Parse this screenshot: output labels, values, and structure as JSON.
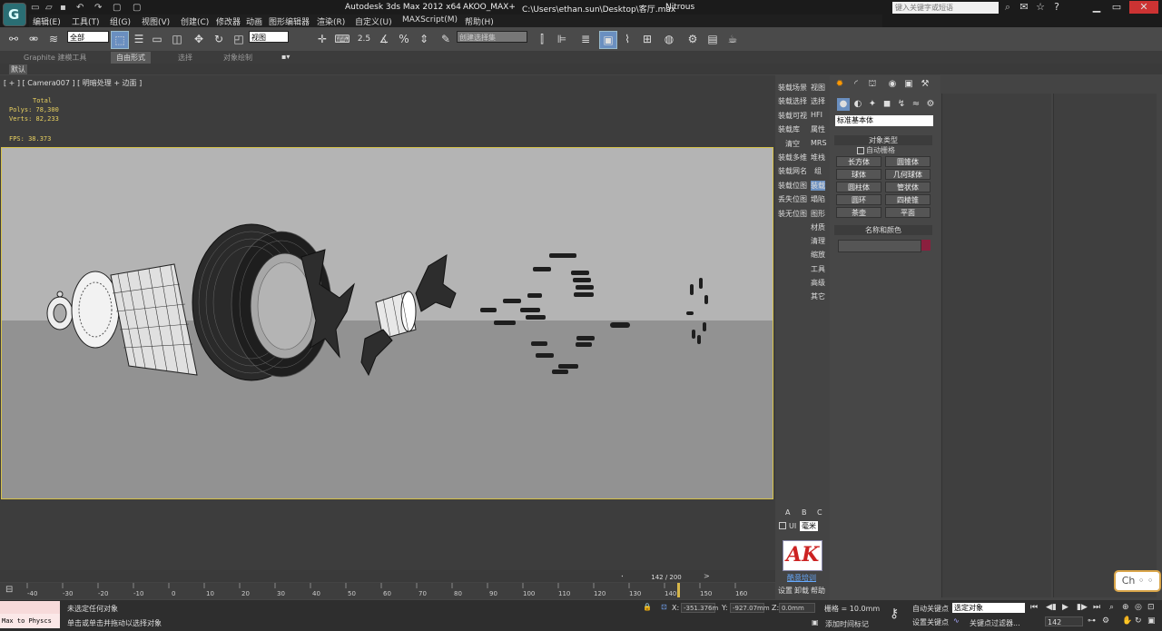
{
  "title_bar": {
    "app_title": "Autodesk 3ds Max  2012 x64",
    "plugin": "AKOO_MAX+",
    "file_path": "C:\\Users\\ethan.sun\\Desktop\\客厅.max",
    "renderer": "Nitrous",
    "search_placeholder": "键入关键字或短语"
  },
  "menu": [
    "编辑(E)",
    "工具(T)",
    "组(G)",
    "视图(V)",
    "创建(C)",
    "修改器",
    "动画",
    "图形编辑器",
    "渲染(R)",
    "自定义(U)",
    "MAXScript(M)",
    "帮助(H)"
  ],
  "toolbar": {
    "selection_filter": "全部",
    "ref_coord": "视图",
    "snap_label": "2.5",
    "named_selection": "创建选择集"
  },
  "ribbon": {
    "tabs": [
      "Graphite 建模工具",
      "自由形式",
      "选择",
      "对象绘制"
    ],
    "active_tab": "自由形式",
    "sub_label": "默认"
  },
  "viewport": {
    "label": "[ + ] [ Camera007 ] [ 明暗处理 + 边面 ]",
    "stats": {
      "total_label": "Total",
      "polys": "Polys: 78,300",
      "verts": "Verts: 82,233",
      "fps": "FPS:   38.373"
    }
  },
  "mid_panel": {
    "left_buttons": [
      "装载场景",
      "装载选择",
      "装载可视",
      "装载库",
      "清空",
      "装载多维",
      "装载网名",
      "装载位图",
      "丢失位图",
      "装无位图"
    ],
    "right_buttons": [
      "视图",
      "选择",
      "HFI",
      "属性",
      "MRS",
      "堆栈",
      "组",
      "装载",
      "塌陷",
      "图形",
      "材质",
      "清理",
      "缩放",
      "工具",
      "高级",
      "其它"
    ],
    "abc": [
      "A",
      "B",
      "C"
    ],
    "ui_label": "UI",
    "unit": "毫米",
    "logo": "AK",
    "training": "酷意培训",
    "bottom_buttons": [
      "设置",
      "卸载",
      "帮助"
    ]
  },
  "command_panel": {
    "category": "标准基本体",
    "object_type_header": "对象类型",
    "autogrid_label": "自动栅格",
    "objects": [
      "长方体",
      "圆锥体",
      "球体",
      "几何球体",
      "圆柱体",
      "管状体",
      "圆环",
      "四棱锥",
      "茶壶",
      "平面"
    ],
    "name_color_header": "名称和颜色",
    "color": "#8b1f3e"
  },
  "ime_badge": "Ch ◦ ◦",
  "time_slider": {
    "frame_label": "142 / 200",
    "ticks": [
      "-40",
      "-30",
      "-20",
      "-10",
      "0",
      "10",
      "20",
      "30",
      "40",
      "50",
      "60",
      "70",
      "80",
      "90",
      "100",
      "110",
      "120",
      "130",
      "140",
      "150",
      "160"
    ]
  },
  "status": {
    "max_listener": "Max to Physcs",
    "selection_info": "未选定任何对象",
    "prompt": "单击或单击并拖动以选择对象",
    "x_label": "X:",
    "x_value": "-351.376m",
    "y_label": "Y:",
    "y_value": "-927.07mm",
    "z_label": "Z:",
    "z_value": "0.0mm",
    "grid": "栅格 = 10.0mm",
    "add_time_tag": "添加时间标记",
    "auto_key": "自动关键点",
    "set_key": "设置关键点",
    "key_mode": "选定对象",
    "key_filters": "关键点过滤器...",
    "current_frame": "142"
  }
}
